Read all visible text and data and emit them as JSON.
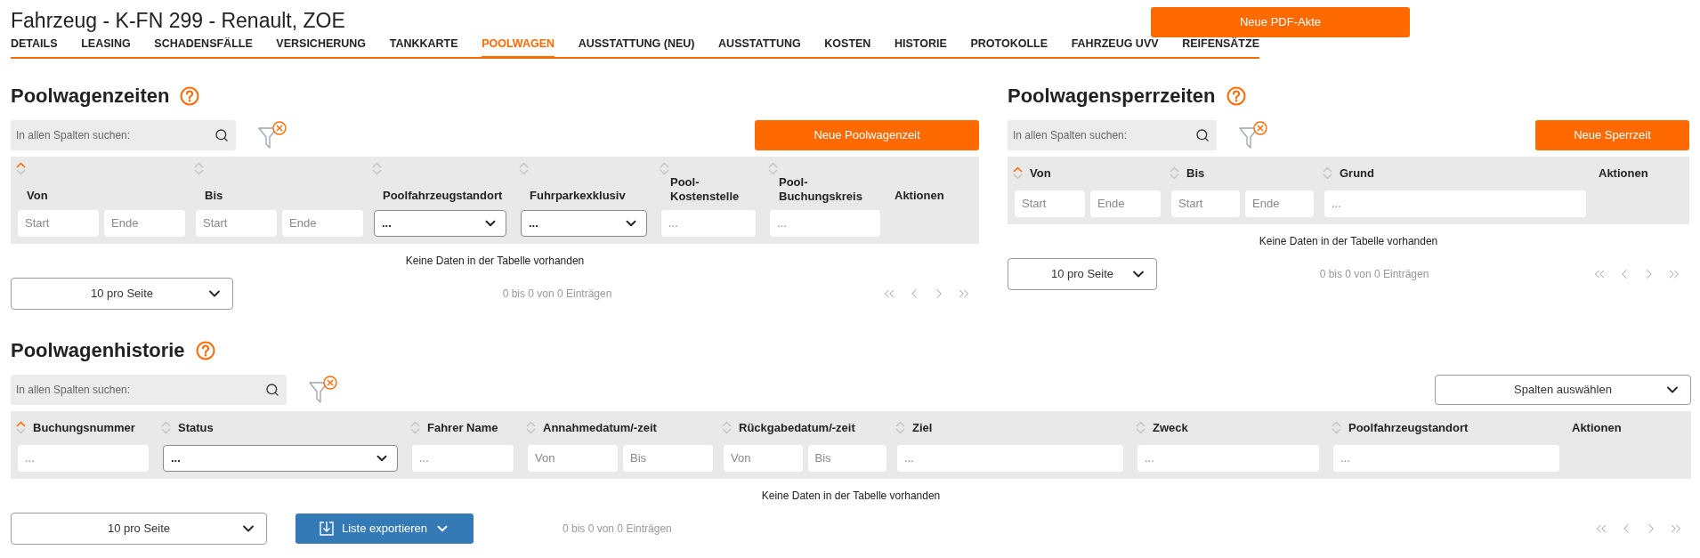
{
  "title": "Fahrzeug - K-FN 299 - Renault, ZOE",
  "pdf_button": "Neue PDF-Akte",
  "tabs": [
    {
      "label": "DETAILS",
      "selected": false
    },
    {
      "label": "LEASING",
      "selected": false
    },
    {
      "label": "SCHADENSFÄLLE",
      "selected": false
    },
    {
      "label": "VERSICHERUNG",
      "selected": false
    },
    {
      "label": "TANKKARTE",
      "selected": false
    },
    {
      "label": "POOLWAGEN",
      "selected": true
    },
    {
      "label": "AUSSTATTUNG (NEU)",
      "selected": false
    },
    {
      "label": "AUSSTATTUNG",
      "selected": false
    },
    {
      "label": "KOSTEN",
      "selected": false
    },
    {
      "label": "HISTORIE",
      "selected": false
    },
    {
      "label": "PROTOKOLLE",
      "selected": false
    },
    {
      "label": "FAHRZEUG UVV",
      "selected": false
    },
    {
      "label": "REIFENSÄTZE",
      "selected": false
    }
  ],
  "sections": [
    {
      "title": "Poolwagenzeiten",
      "search": {
        "placeholder": "In allen Spalten suchen:"
      },
      "action_button": "Neue Poolwagenzeit",
      "columns": [
        {
          "label": "Von",
          "sorted": true,
          "filter": {
            "kind": "range",
            "placeholders": [
              "Start",
              "Ende"
            ]
          }
        },
        {
          "label": "Bis",
          "sorted": false,
          "filter": {
            "kind": "range",
            "placeholders": [
              "Start",
              "Ende"
            ]
          }
        },
        {
          "label": "Poolfahrzeugstandort",
          "sorted": false,
          "filter": {
            "kind": "select",
            "value": "..."
          }
        },
        {
          "label": "Fuhrparkexklusiv",
          "sorted": false,
          "filter": {
            "kind": "select",
            "value": "..."
          }
        },
        {
          "label": "Pool-Kostenstelle",
          "sorted": false,
          "filter": {
            "kind": "text",
            "placeholder": "..."
          }
        },
        {
          "label": "Pool-Buchungskreis",
          "sorted": false,
          "filter": {
            "kind": "text",
            "placeholder": "..."
          }
        },
        {
          "label": "Aktionen"
        }
      ],
      "empty_message": "Keine Daten in der Tabelle vorhanden",
      "page_size": "10 pro Seite",
      "entries_info": "0 bis 0 von 0 Einträgen"
    },
    {
      "title": "Poolwagensperrzeiten",
      "search": {
        "placeholder": "In allen Spalten suchen:"
      },
      "action_button": "Neue Sperrzeit",
      "columns": [
        {
          "label": "Von",
          "sorted": true,
          "filter": {
            "kind": "range",
            "placeholders": [
              "Start",
              "Ende"
            ]
          }
        },
        {
          "label": "Bis",
          "sorted": false,
          "filter": {
            "kind": "range",
            "placeholders": [
              "Start",
              "Ende"
            ]
          }
        },
        {
          "label": "Grund",
          "sorted": false,
          "filter": {
            "kind": "text",
            "placeholder": "..."
          }
        },
        {
          "label": "Aktionen"
        }
      ],
      "empty_message": "Keine Daten in der Tabelle vorhanden",
      "page_size": "10 pro Seite",
      "entries_info": "0 bis 0 von 0 Einträgen"
    },
    {
      "title": "Poolwagenhistorie",
      "search": {
        "placeholder": "In allen Spalten suchen:"
      },
      "column_picker": "Spalten auswählen",
      "columns": [
        {
          "label": "Buchungsnummer",
          "sorted": true,
          "filter": {
            "kind": "text",
            "placeholder": "..."
          }
        },
        {
          "label": "Status",
          "sorted": false,
          "filter": {
            "kind": "select",
            "value": "..."
          }
        },
        {
          "label": "Fahrer Name",
          "sorted": false,
          "filter": {
            "kind": "text",
            "placeholder": "..."
          }
        },
        {
          "label": "Annahmedatum/-zeit",
          "sorted": false,
          "filter": {
            "kind": "range",
            "placeholders": [
              "Von",
              "Bis"
            ]
          }
        },
        {
          "label": "Rückgabedatum/-zeit",
          "sorted": false,
          "filter": {
            "kind": "range",
            "placeholders": [
              "Von",
              "Bis"
            ]
          }
        },
        {
          "label": "Ziel",
          "sorted": false,
          "filter": {
            "kind": "text",
            "placeholder": "..."
          }
        },
        {
          "label": "Zweck",
          "sorted": false,
          "filter": {
            "kind": "text",
            "placeholder": "..."
          }
        },
        {
          "label": "Poolfahrzeugstandort",
          "sorted": false,
          "filter": {
            "kind": "text",
            "placeholder": "..."
          }
        },
        {
          "label": "Aktionen"
        }
      ],
      "empty_message": "Keine Daten in der Tabelle vorhanden",
      "page_size": "10 pro Seite",
      "export_button": "Liste exportieren",
      "entries_info": "0 bis 0 von 0 Einträgen"
    }
  ]
}
